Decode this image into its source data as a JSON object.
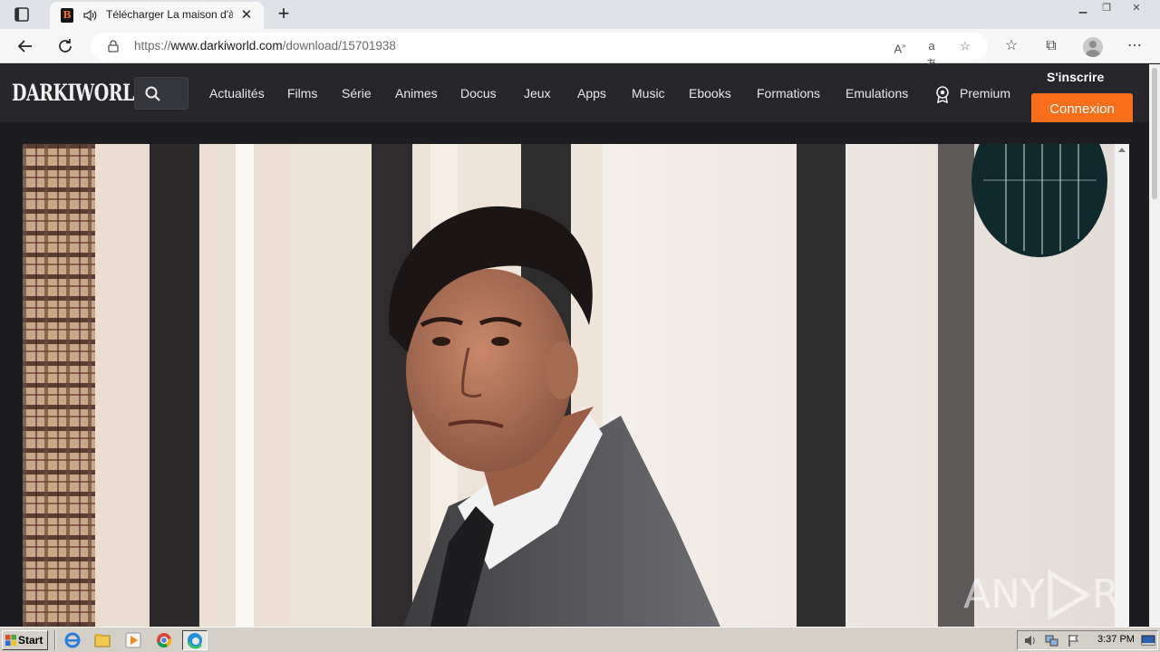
{
  "browser": {
    "tab": {
      "title": "Télécharger La maison d'à",
      "favicon_letter": "B"
    },
    "url_prefix": "https://",
    "url_host": "www.darkiworld.com",
    "url_path": "/download/15701938"
  },
  "site": {
    "logo": "DARKIWORLD",
    "nav": [
      "Actualités",
      "Films",
      "Série",
      "Animes",
      "Docus",
      "Jeux",
      "Apps",
      "Music",
      "Ebooks",
      "Formations",
      "Emulations"
    ],
    "premium": "Premium",
    "signup": "S'inscrire",
    "login": "Connexion",
    "accent_color": "#f86e1a"
  },
  "watermark": {
    "left": "ANY",
    "right": "RUN"
  },
  "taskbar": {
    "start_label": "Start",
    "clock": "3:37 PM"
  }
}
